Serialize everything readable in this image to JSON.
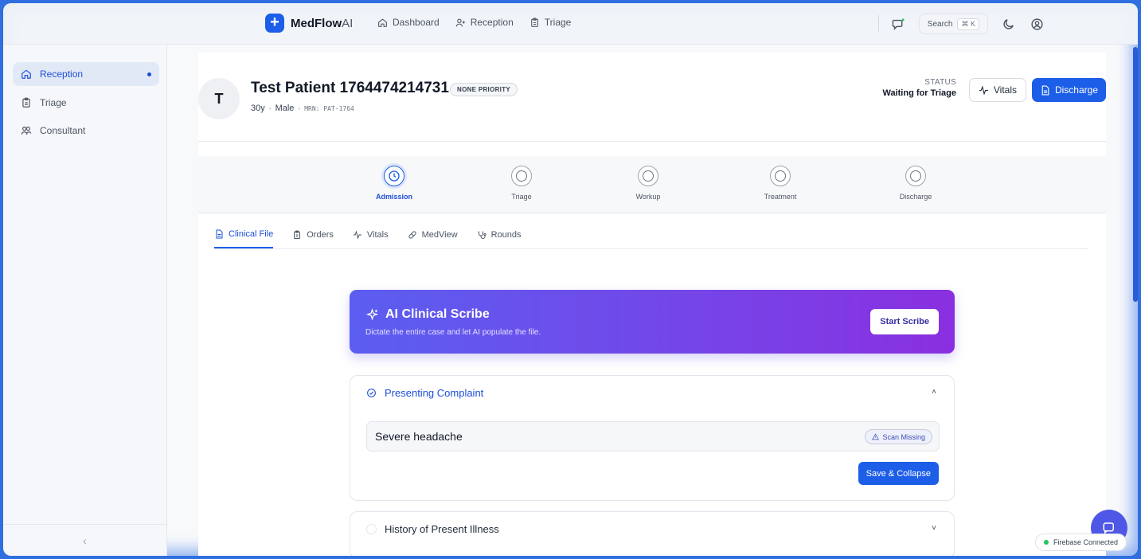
{
  "brand": {
    "name": "MedFlow",
    "suffix": "AI",
    "logo_glyph": "+"
  },
  "topnav": {
    "links": [
      {
        "label": "Dashboard",
        "icon": "home-icon"
      },
      {
        "label": "Reception",
        "icon": "user-plus-icon"
      },
      {
        "label": "Triage",
        "icon": "clipboard-icon"
      }
    ],
    "search_label": "Search",
    "search_kbd": "⌘ K"
  },
  "sidebar": {
    "items": [
      {
        "label": "Reception",
        "icon": "home-icon",
        "active": true
      },
      {
        "label": "Triage",
        "icon": "clipboard-icon",
        "active": false
      },
      {
        "label": "Consultant",
        "icon": "users-icon",
        "active": false
      }
    ],
    "collapse_glyph": "‹"
  },
  "patient": {
    "initial": "T",
    "name": "Test Patient 1764474214731",
    "priority": "NONE PRIORITY",
    "age": "30y",
    "sex": "Male",
    "mrn": "MRN: PAT-1764",
    "status_label": "STATUS",
    "status_value": "Waiting for Triage",
    "vitals_label": "Vitals",
    "discharge_label": "Discharge"
  },
  "stepper": {
    "steps": [
      {
        "label": "Admission",
        "active": true
      },
      {
        "label": "Triage",
        "active": false
      },
      {
        "label": "Workup",
        "active": false
      },
      {
        "label": "Treatment",
        "active": false
      },
      {
        "label": "Discharge",
        "active": false
      }
    ]
  },
  "tabs": [
    {
      "label": "Clinical File",
      "active": true
    },
    {
      "label": "Orders",
      "active": false
    },
    {
      "label": "Vitals",
      "active": false
    },
    {
      "label": "MedView",
      "active": false
    },
    {
      "label": "Rounds",
      "active": false
    }
  ],
  "scribe": {
    "title": "AI Clinical Scribe",
    "subtitle": "Dictate the entire case and let AI populate the file.",
    "button": "Start Scribe"
  },
  "presenting_complaint": {
    "title": "Presenting Complaint",
    "value": "Severe headache",
    "scan_badge": "Scan Missing",
    "save_button": "Save & Collapse",
    "chevron": "˄"
  },
  "hpi": {
    "title": "History of Present Illness",
    "chevron": "˅"
  },
  "firebase_status": "Firebase Connected",
  "colors": {
    "primary": "#1d5ee8",
    "scribe_start": "#5b5ef0",
    "scribe_end": "#8a2fe0",
    "connected": "#22c55e"
  }
}
